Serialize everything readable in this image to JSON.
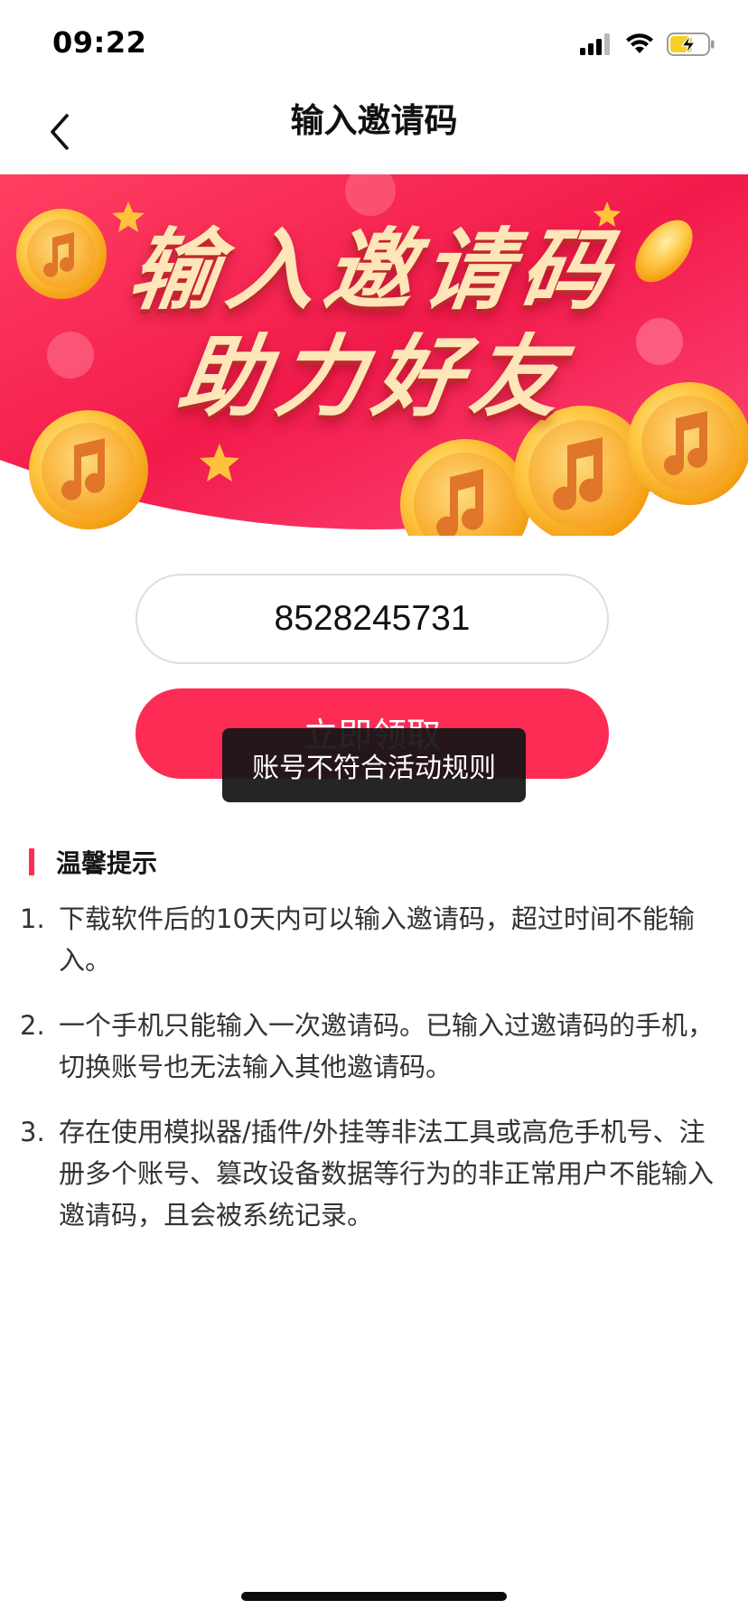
{
  "status_bar": {
    "time": "09:22",
    "icons": [
      "signal-icon",
      "wifi-icon",
      "battery-charging-icon"
    ]
  },
  "nav": {
    "title": "输入邀请码",
    "back_icon": "chevron-left-icon"
  },
  "banner": {
    "line1": "输入邀请码",
    "line2": "助力好友",
    "colors": {
      "primary": "#fd2c55",
      "secondary": "#e8174a",
      "coin": "#f9b233"
    }
  },
  "form": {
    "invite_code_value": "8528245731",
    "claim_button_label": "立即领取"
  },
  "toast": {
    "message": "账号不符合活动规则"
  },
  "tips": {
    "title": "温馨提示",
    "items": [
      {
        "num": "1.",
        "text": "下载软件后的10天内可以输入邀请码，超过时间不能输入。"
      },
      {
        "num": "2.",
        "text": "一个手机只能输入一次邀请码。已输入过邀请码的手机，切换账号也无法输入其他邀请码。"
      },
      {
        "num": "3.",
        "text": "存在使用模拟器/插件/外挂等非法工具或高危手机号、注册多个账号、篡改设备数据等行为的非正常用户不能输入邀请码，且会被系统记录。"
      }
    ]
  },
  "theme": {
    "accent": "#fd2c55",
    "toast_bg": "#141414"
  }
}
